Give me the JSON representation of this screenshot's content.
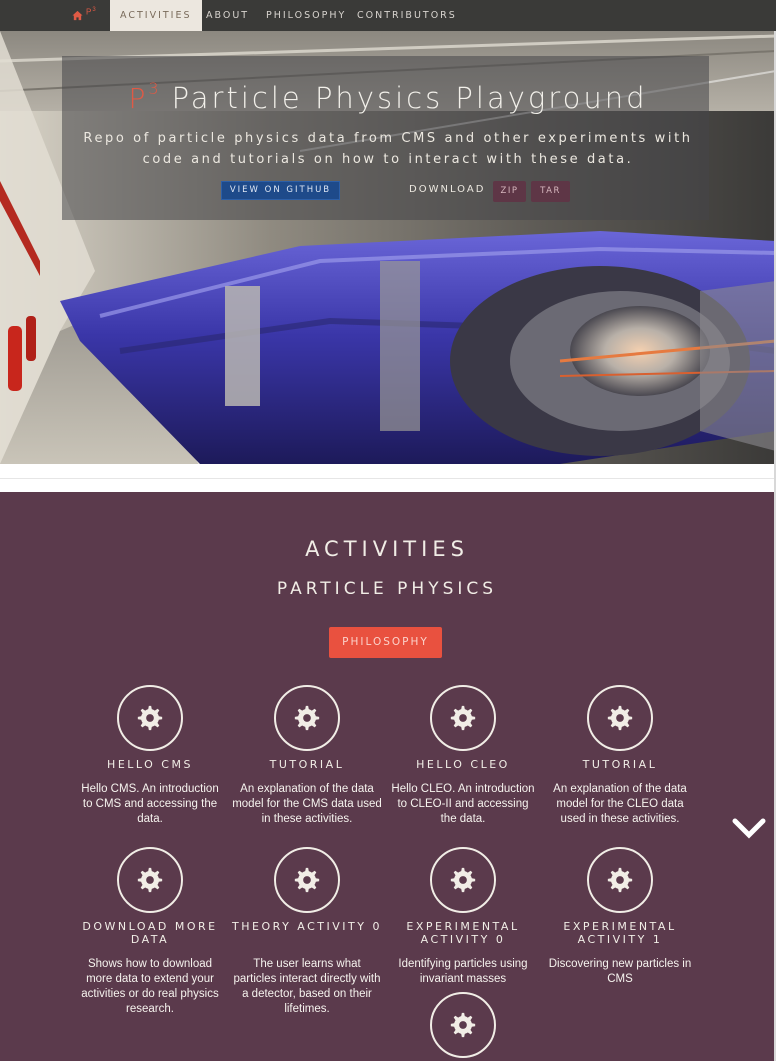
{
  "navbar": {
    "brand_text": "P",
    "brand_sup": "3",
    "items": [
      {
        "label": "ACTIVITIES",
        "active": true
      },
      {
        "label": "ABOUT",
        "active": false
      },
      {
        "label": "PHILOSOPHY",
        "active": false
      },
      {
        "label": "CONTRIBUTORS",
        "active": false
      }
    ]
  },
  "hero": {
    "title_p": "P",
    "title_sup": "3",
    "title": "Particle Physics Playground",
    "subtitle_line1": "Repo of particle physics data from CMS and other experiments with",
    "subtitle_line2": "code and tutorials on how to interact with these data.",
    "github_button": "VIEW ON GITHUB",
    "download_label": "DOWNLOAD",
    "zip_button": "ZIP",
    "tar_button": "TAR"
  },
  "activities": {
    "title": "ACTIVITIES",
    "subtitle": "PARTICLE PHYSICS",
    "philosophy_button": "PHILOSOPHY",
    "cards": [
      {
        "title": "HELLO CMS",
        "desc": "Hello CMS. An introduction to CMS and accessing the data.",
        "icon": "gear-icon"
      },
      {
        "title": "TUTORIAL",
        "desc": "An explanation of the data model for the CMS data used in these activities.",
        "icon": "gear-icon"
      },
      {
        "title": "HELLO CLEO",
        "desc": "Hello CLEO. An introduction to CLEO-II and accessing the data.",
        "icon": "gear-icon"
      },
      {
        "title": "TUTORIAL",
        "desc": "An explanation of the data model for the CLEO data used in these activities.",
        "icon": "gear-icon"
      },
      {
        "title": "DOWNLOAD MORE DATA",
        "desc": "Shows how to download more data to extend your activities or do real physics research.",
        "icon": "gear-icon"
      },
      {
        "title": "THEORY ACTIVITY 0",
        "desc": "The user learns what particles interact directly with a detector, based on their lifetimes.",
        "icon": "gear-icon"
      },
      {
        "title": "EXPERIMENTAL ACTIVITY 0",
        "desc": "Identifying particles using invariant masses",
        "icon": "gear-icon"
      },
      {
        "title": "EXPERIMENTAL ACTIVITY 1",
        "desc": "Discovering new particles in CMS",
        "icon": "gear-icon"
      },
      {
        "title": "",
        "desc": "",
        "icon": "gear-icon"
      }
    ]
  },
  "colors": {
    "nav_bg": "#3a3a38",
    "accent": "#e05a45",
    "section_bg": "#5b3a4c",
    "github_blue": "#1e4a8a"
  }
}
